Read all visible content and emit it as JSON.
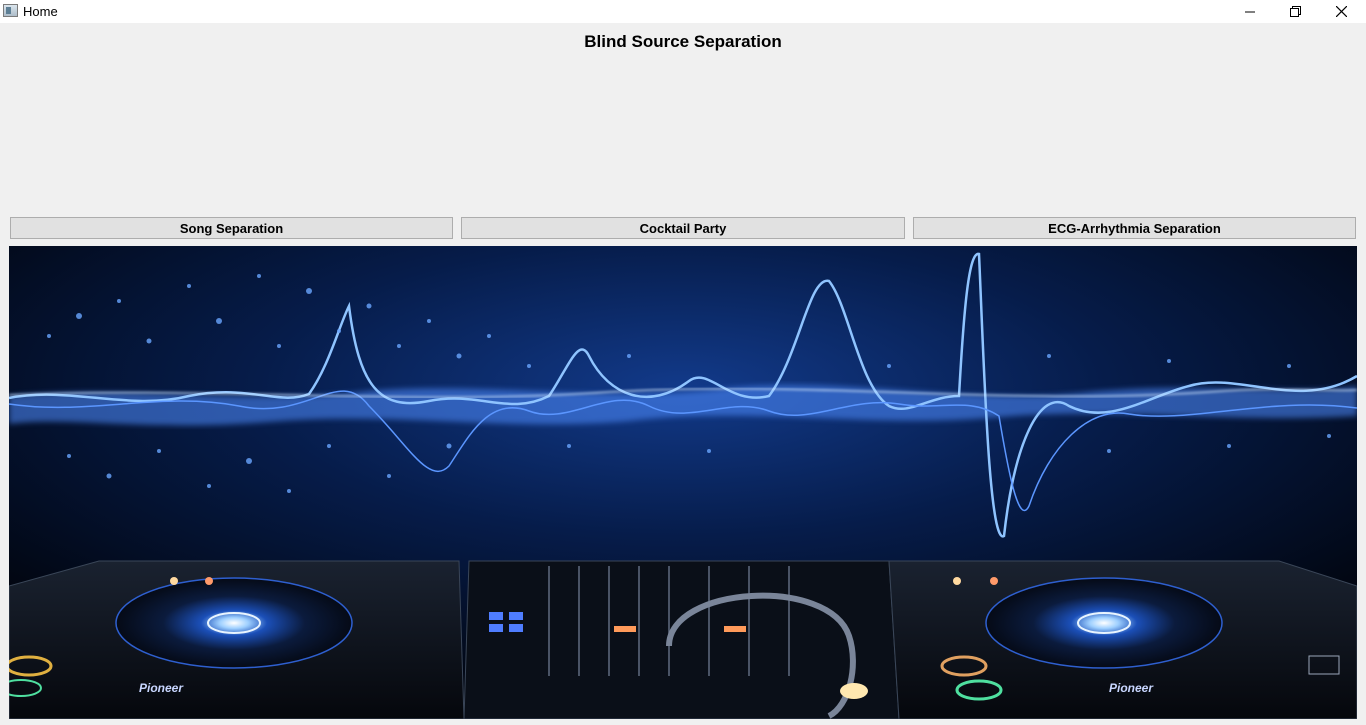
{
  "window": {
    "title": "Home",
    "controls": {
      "minimize": "minimize-icon",
      "restore": "restore-icon",
      "close": "close-icon"
    }
  },
  "page": {
    "heading": "Blind Source Separation"
  },
  "buttons": [
    {
      "label": "Song Separation"
    },
    {
      "label": "Cocktail Party"
    },
    {
      "label": "ECG-Arrhythmia Separation"
    }
  ],
  "hero_image": {
    "description_icon": "dj-turntables-soundwave-image",
    "brand_left": "Pioneer",
    "brand_right": "Pioneer",
    "colors": {
      "background": "#02060f",
      "wave": "#4f8dff",
      "glow": "#bfe0ff"
    }
  }
}
